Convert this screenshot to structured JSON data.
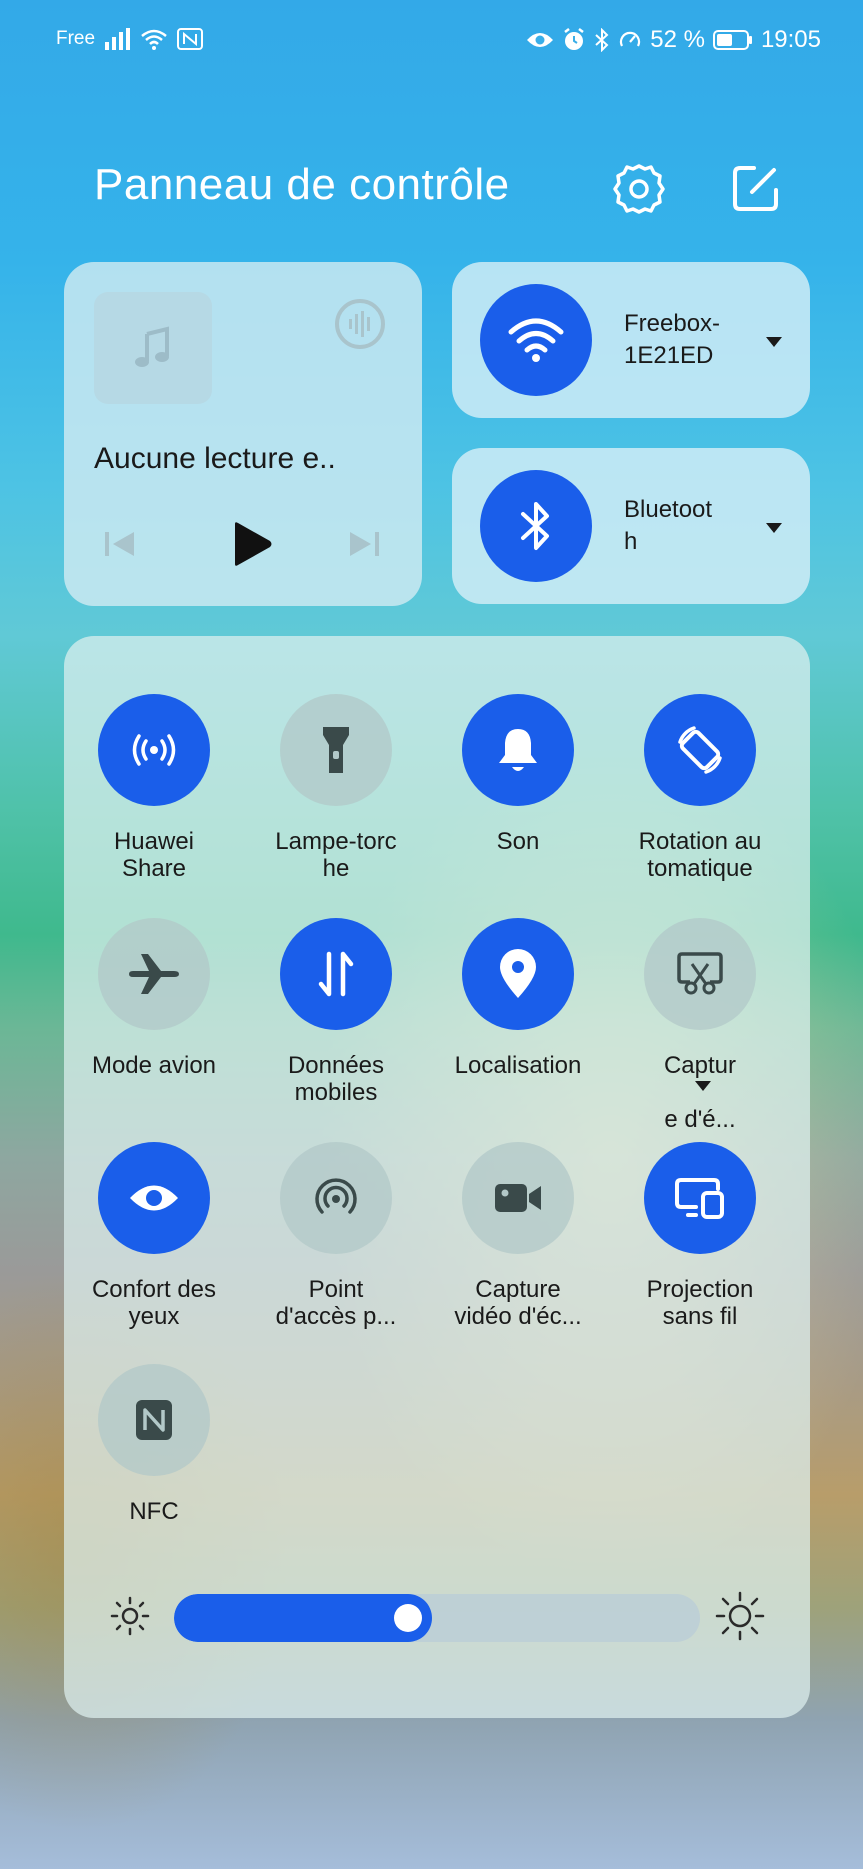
{
  "status_bar": {
    "carrier": "Free",
    "battery_text": "52 %",
    "battery_percent": 52,
    "time": "19:05"
  },
  "header": {
    "title": "Panneau de contrôle"
  },
  "media": {
    "title": "Aucune lecture e.."
  },
  "wifi": {
    "label_line1": "Freebox-",
    "label_line2": "1E21ED"
  },
  "bluetooth": {
    "label_line1": "Bluetoot",
    "label_line2": "h"
  },
  "tiles": [
    {
      "line1": "Huawei",
      "line2": "Share",
      "state": "on",
      "icon": "huawei-share-icon"
    },
    {
      "line1": "Lampe-torc",
      "line2": "he",
      "state": "off",
      "icon": "flashlight-icon"
    },
    {
      "line1": "Son",
      "line2": "",
      "state": "on",
      "icon": "bell-icon"
    },
    {
      "line1": "Rotation au",
      "line2": "tomatique",
      "state": "on",
      "icon": "auto-rotate-icon"
    },
    {
      "line1": "Mode avion",
      "line2": "",
      "state": "off",
      "icon": "airplane-icon"
    },
    {
      "line1": "Données",
      "line2": "mobiles",
      "state": "on",
      "icon": "mobile-data-icon"
    },
    {
      "line1": "Localisation",
      "line2": "",
      "state": "on",
      "icon": "location-icon"
    },
    {
      "line1": "Captur",
      "line2": "e d'é...",
      "state": "off",
      "icon": "screenshot-icon"
    },
    {
      "line1": "Confort des",
      "line2": "yeux",
      "state": "on",
      "icon": "eye-icon"
    },
    {
      "line1": "Point",
      "line2": "d'accès p...",
      "state": "off",
      "icon": "hotspot-icon"
    },
    {
      "line1": "Capture",
      "line2": "vidéo d'éc...",
      "state": "off",
      "icon": "screen-record-icon"
    },
    {
      "line1": "Projection",
      "line2": "sans fil",
      "state": "on",
      "icon": "wireless-projection-icon"
    },
    {
      "line1": "NFC",
      "line2": "",
      "state": "off",
      "icon": "nfc-icon"
    }
  ],
  "brightness": {
    "level_percent": 49
  },
  "colors": {
    "accent": "#1a5eea",
    "tile_off": "#b2c8c8"
  }
}
